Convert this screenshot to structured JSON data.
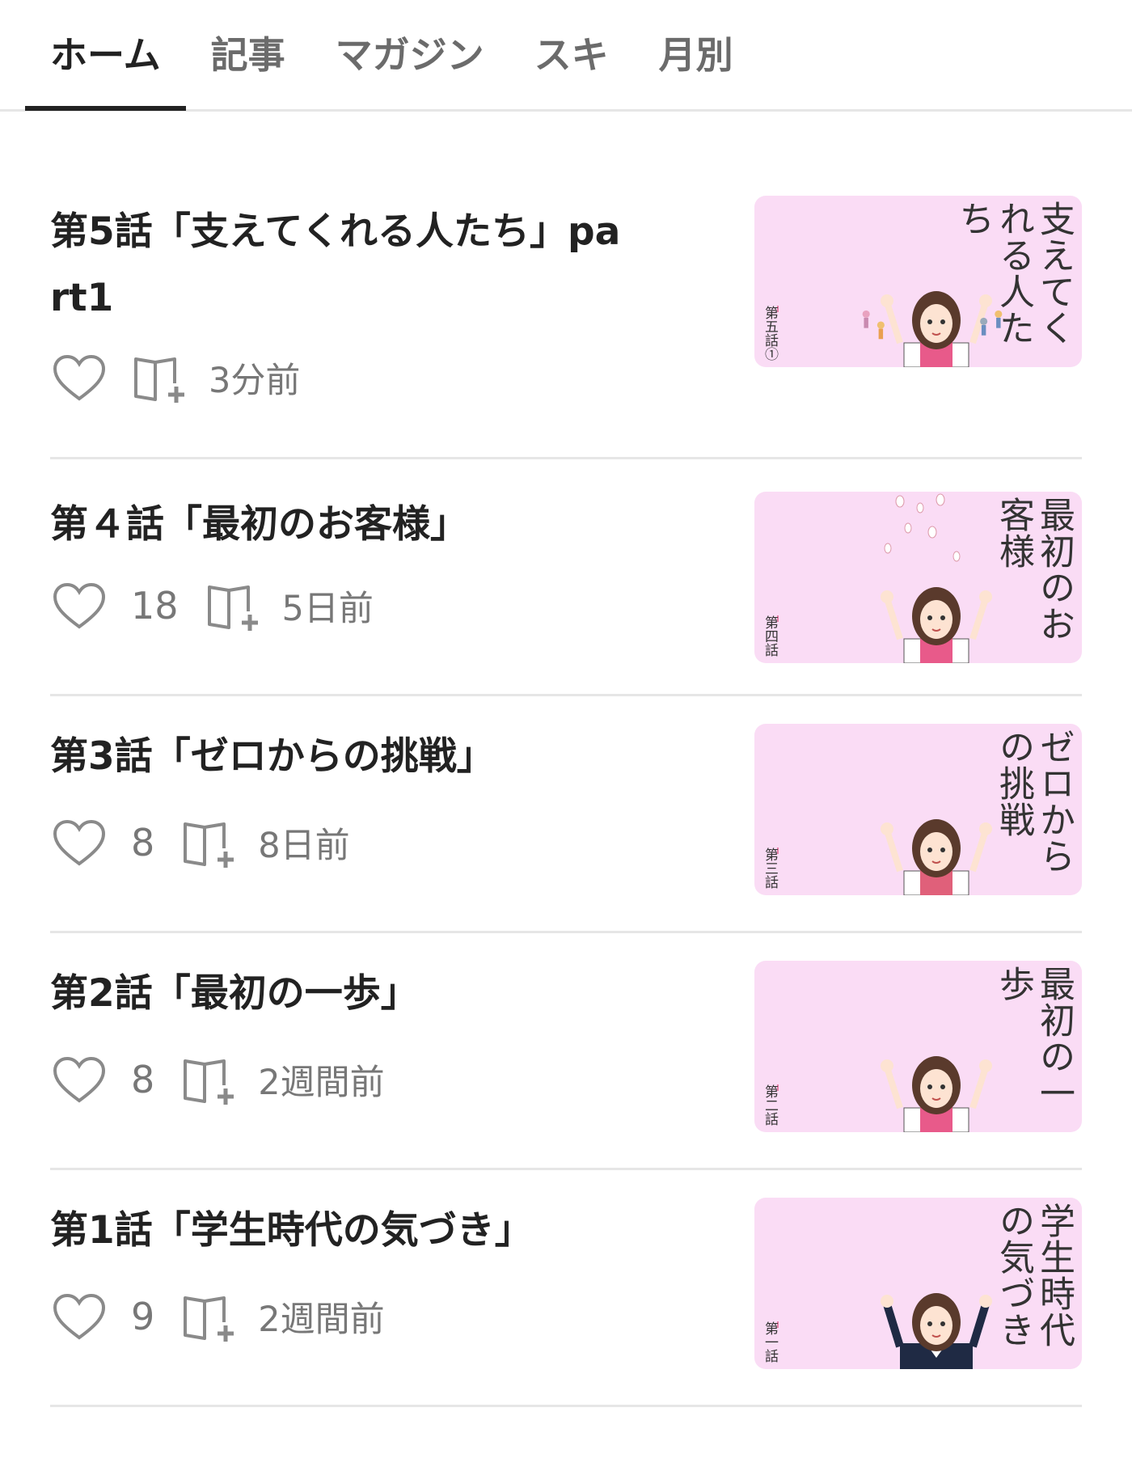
{
  "tabs": [
    {
      "label": "ホーム",
      "active": true
    },
    {
      "label": "記事",
      "active": false
    },
    {
      "label": "マガジン",
      "active": false
    },
    {
      "label": "スキ",
      "active": false
    },
    {
      "label": "月別",
      "active": false
    }
  ],
  "articles": [
    {
      "title": "第5話「支えてくれる人たち」part1",
      "likes": "",
      "time": "3分前",
      "thumb_text": "支えてくれる人たち",
      "thumb_label": "第五話①"
    },
    {
      "title": "第４話「最初のお客様」",
      "likes": "18",
      "time": "5日前",
      "thumb_text": "最初のお客様",
      "thumb_label": "第四話"
    },
    {
      "title": "第3話「ゼロからの挑戦」",
      "likes": "8",
      "time": "8日前",
      "thumb_text": "ゼロからの挑戦",
      "thumb_label": "第三話"
    },
    {
      "title": "第2話「最初の一歩」",
      "likes": "8",
      "time": "2週間前",
      "thumb_text": "最初の一歩",
      "thumb_label": "第二話"
    },
    {
      "title": "第1話「学生時代の気づき」",
      "likes": "9",
      "time": "2週間前",
      "thumb_text": "学生時代の気づき",
      "thumb_label": "第一話"
    }
  ],
  "icons": {
    "like": "heart-icon",
    "add_to_magazine": "book-add-icon"
  },
  "colors": {
    "thumb_bg": "#fadcf5",
    "active_tab": "#222222",
    "muted": "#777777",
    "divider": "#e6e6e6"
  }
}
